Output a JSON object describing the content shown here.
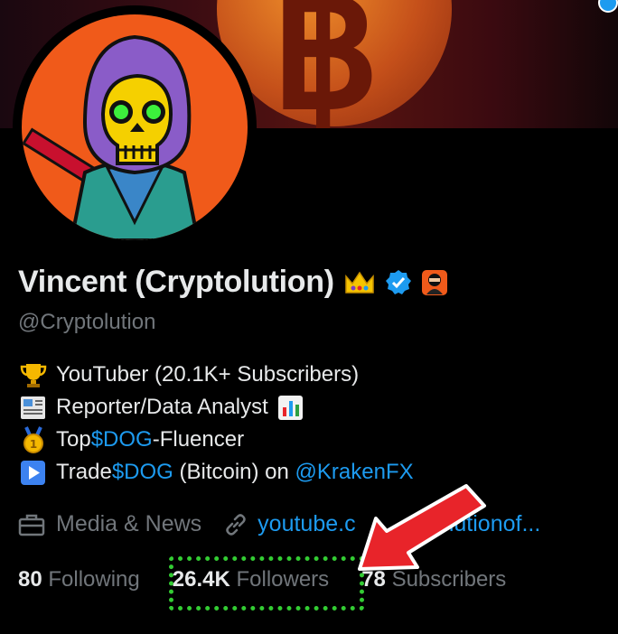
{
  "profile": {
    "name": "Vincent (Cryptolution)",
    "handle": "@Cryptolution",
    "bio": {
      "line1_text": "YouTuber (20.1K+ Subscribers)",
      "line2_text": "Reporter/Data Analyst",
      "line3_pre": "Top ",
      "line3_link": "$DOG",
      "line3_post": "-Fluencer",
      "line4_pre": "Trade ",
      "line4_link": "$DOG",
      "line4_mid": " (Bitcoin) on ",
      "line4_mention": "@KrakenFX"
    },
    "category": "Media & News",
    "website": "youtube.c",
    "website_tail": "yptolutionof..."
  },
  "stats": {
    "following_count": "80",
    "following_label": "Following",
    "followers_count": "26.4K",
    "followers_label": "Followers",
    "subscribers_count": "78",
    "subscribers_label": "Subscribers"
  },
  "icons": [
    "bitcoin-banner",
    "avatar-skull-icon",
    "crown-icon",
    "verified-badge-icon",
    "ninja-emoji-icon",
    "trophy-icon",
    "newspaper-icon",
    "bar-chart-icon",
    "medal-icon",
    "play-icon",
    "briefcase-icon",
    "link-icon",
    "red-arrow-icon"
  ],
  "colors": {
    "accent_blue": "#1d9bf0",
    "muted": "#71767b",
    "highlight_dots": "#33cc33",
    "arrow_red": "#e8242a",
    "avatar_bg": "#f05a1a"
  }
}
